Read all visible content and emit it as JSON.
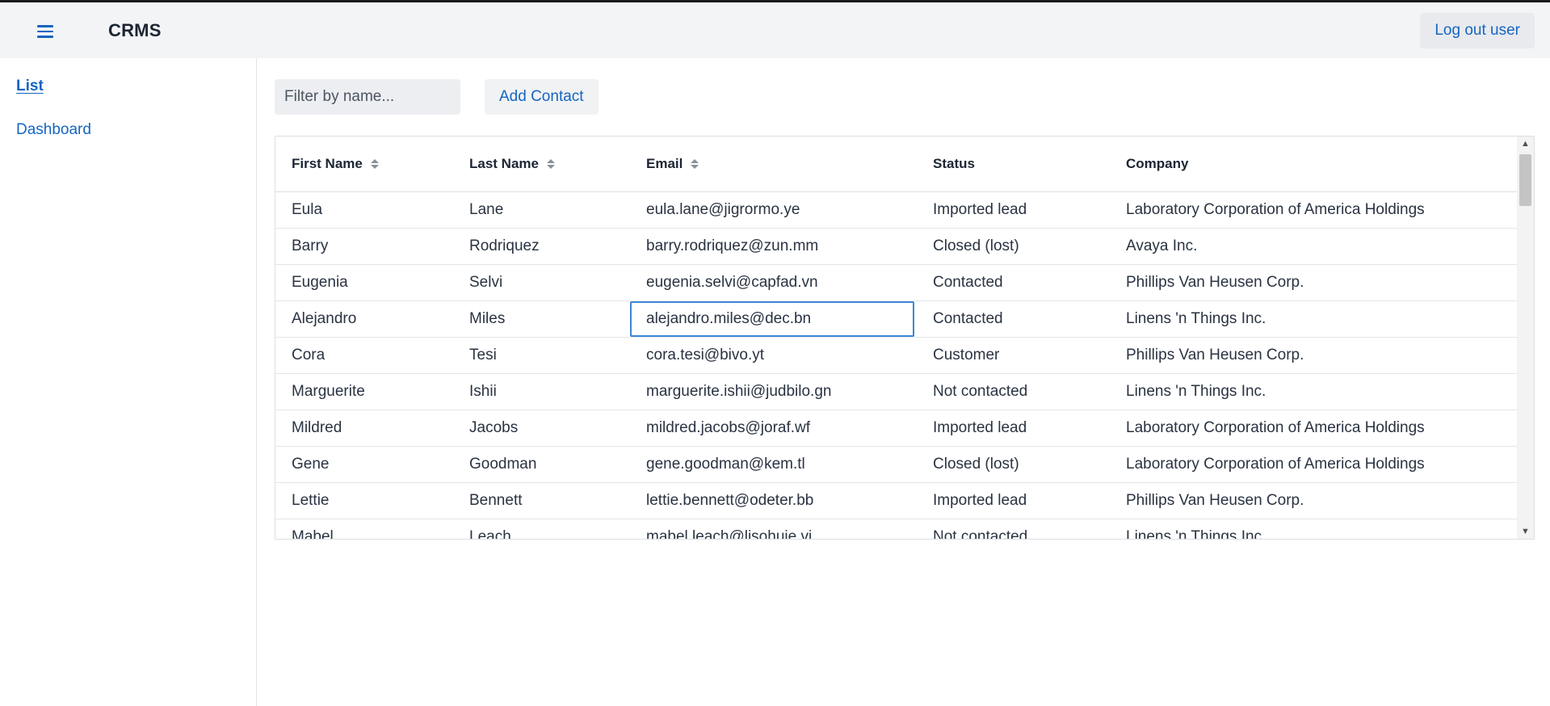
{
  "app": {
    "title": "CRMS"
  },
  "header": {
    "logout_label": "Log out user"
  },
  "sidebar": {
    "items": [
      {
        "label": "List",
        "active": true
      },
      {
        "label": "Dashboard",
        "active": false
      }
    ]
  },
  "toolbar": {
    "filter_placeholder": "Filter by name...",
    "filter_value": "",
    "add_label": "Add Contact"
  },
  "table": {
    "columns": [
      {
        "label": "First Name",
        "sortable": true
      },
      {
        "label": "Last Name",
        "sortable": true
      },
      {
        "label": "Email",
        "sortable": true
      },
      {
        "label": "Status",
        "sortable": false
      },
      {
        "label": "Company",
        "sortable": false
      }
    ],
    "rows": [
      [
        "Eula",
        "Lane",
        "eula.lane@jigrormo.ye",
        "Imported lead",
        "Laboratory Corporation of America Holdings"
      ],
      [
        "Barry",
        "Rodriquez",
        "barry.rodriquez@zun.mm",
        "Closed (lost)",
        "Avaya Inc."
      ],
      [
        "Eugenia",
        "Selvi",
        "eugenia.selvi@capfad.vn",
        "Contacted",
        "Phillips Van Heusen Corp."
      ],
      [
        "Alejandro",
        "Miles",
        "alejandro.miles@dec.bn",
        "Contacted",
        "Linens 'n Things Inc."
      ],
      [
        "Cora",
        "Tesi",
        "cora.tesi@bivo.yt",
        "Customer",
        "Phillips Van Heusen Corp."
      ],
      [
        "Marguerite",
        "Ishii",
        "marguerite.ishii@judbilo.gn",
        "Not contacted",
        "Linens 'n Things Inc."
      ],
      [
        "Mildred",
        "Jacobs",
        "mildred.jacobs@joraf.wf",
        "Imported lead",
        "Laboratory Corporation of America Holdings"
      ],
      [
        "Gene",
        "Goodman",
        "gene.goodman@kem.tl",
        "Closed (lost)",
        "Laboratory Corporation of America Holdings"
      ],
      [
        "Lettie",
        "Bennett",
        "lettie.bennett@odeter.bb",
        "Imported lead",
        "Phillips Van Heusen Corp."
      ],
      [
        "Mabel",
        "Leach",
        "mabel.leach@lisohuje.vi",
        "Not contacted",
        "Linens 'n Things Inc."
      ]
    ],
    "focused_cell": {
      "row": 3,
      "col": 2
    }
  },
  "icons": {
    "menu": "hamburger-menu-icon",
    "sort": "sort-arrows-icon",
    "scroll_up": "chevron-up-icon",
    "scroll_down": "chevron-down-icon"
  },
  "colors": {
    "accent": "#1565c0",
    "topbar_bg": "#f3f4f6",
    "focus_border": "#3d86d8"
  }
}
